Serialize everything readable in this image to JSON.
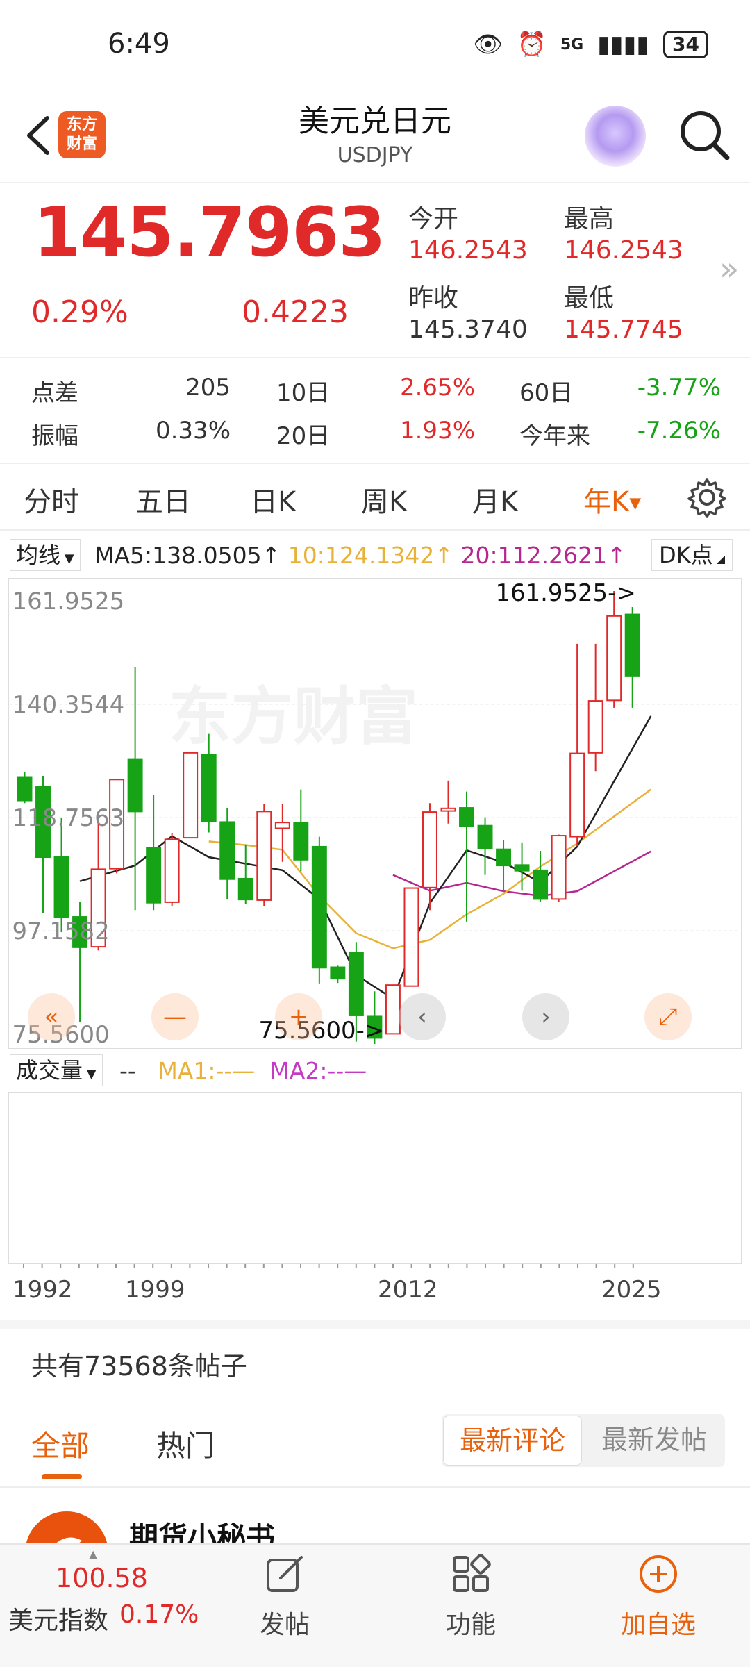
{
  "status": {
    "time": "6:49",
    "network": "5G",
    "battery": "34"
  },
  "header": {
    "title": "美元兑日元",
    "subtitle": "USDJPY",
    "logo_text": "东方财富"
  },
  "quote": {
    "price": "145.7963",
    "change_pct": "0.29%",
    "change_val": "0.4223",
    "open_label": "今开",
    "open": "146.2543",
    "high_label": "最高",
    "high": "146.2543",
    "prev_close_label": "昨收",
    "prev_close": "145.3740",
    "low_label": "最低",
    "low": "145.7745",
    "more": "»"
  },
  "stats": {
    "spread_label": "点差",
    "spread": "205",
    "d10_label": "10日",
    "d10": "2.65%",
    "d60_label": "60日",
    "d60": "-3.77%",
    "amplitude_label": "振幅",
    "amplitude": "0.33%",
    "d20_label": "20日",
    "d20": "1.93%",
    "ytd_label": "今年来",
    "ytd": "-7.26%"
  },
  "tabs": [
    "分时",
    "五日",
    "日K",
    "周K",
    "月K",
    "年K"
  ],
  "active_tab": "年K",
  "ma": {
    "selector": "均线",
    "ma5": "MA5:138.0505↑",
    "ma10": "10:124.1342↑",
    "ma20": "20:112.2621↑",
    "dk": "DK点"
  },
  "colors": {
    "up": "#e02a2a",
    "down": "#16a316",
    "accent": "#e8620d",
    "ma5": "#222222",
    "ma10": "#e8b23a",
    "ma20": "#b5268f"
  },
  "chart_data": {
    "type": "candlestick",
    "y_ticks": [
      "161.9525",
      "140.3544",
      "118.7563",
      "97.1582",
      "75.5600"
    ],
    "ylim": [
      75.56,
      161.9525
    ],
    "x_labels": [
      "1992",
      "1999",
      "2012",
      "2025"
    ],
    "annotations": {
      "high": "161.9525->",
      "low": "75.5600->"
    },
    "candles": [
      {
        "o": 126.5,
        "h": 127.5,
        "c": 122.0,
        "l": 121.5
      },
      {
        "o": 124.7,
        "h": 126.7,
        "c": 111.2,
        "l": 100.5
      },
      {
        "o": 111.3,
        "h": 118.7,
        "c": 99.7,
        "l": 96.9
      },
      {
        "o": 99.8,
        "h": 102.6,
        "c": 94.0,
        "l": 79.8
      },
      {
        "o": 94.1,
        "h": 118.7,
        "c": 108.9,
        "l": 93.4
      },
      {
        "o": 109.0,
        "h": 121.2,
        "c": 126.0,
        "l": 108.1
      },
      {
        "o": 129.8,
        "h": 147.5,
        "c": 119.9,
        "l": 101.1
      },
      {
        "o": 113.0,
        "h": 123.1,
        "c": 102.5,
        "l": 101.1
      },
      {
        "o": 102.6,
        "h": 115.7,
        "c": 114.6,
        "l": 101.9
      },
      {
        "o": 114.9,
        "h": 131.0,
        "c": 131.1,
        "l": 114.8
      },
      {
        "o": 130.8,
        "h": 134.7,
        "c": 118.0,
        "l": 115.9
      },
      {
        "o": 117.9,
        "h": 120.5,
        "c": 107.0,
        "l": 103.1
      },
      {
        "o": 107.1,
        "h": 113.6,
        "c": 103.1,
        "l": 102.3
      },
      {
        "o": 103.0,
        "h": 121.3,
        "c": 119.9,
        "l": 101.8
      },
      {
        "o": 116.7,
        "h": 121.3,
        "c": 117.8,
        "l": 110.3
      },
      {
        "o": 117.8,
        "h": 124.1,
        "c": 110.7,
        "l": 108.5
      },
      {
        "o": 113.2,
        "h": 115.1,
        "c": 90.1,
        "l": 87.1
      },
      {
        "o": 90.2,
        "h": 90.5,
        "c": 88.0,
        "l": 87.2
      },
      {
        "o": 93.0,
        "h": 95.0,
        "c": 81.0,
        "l": 76.0
      },
      {
        "o": 80.8,
        "h": 85.6,
        "c": 76.7,
        "l": 75.56
      },
      {
        "o": 77.5,
        "h": 84.3,
        "c": 86.8,
        "l": 77.5
      },
      {
        "o": 86.6,
        "h": 105.4,
        "c": 105.3,
        "l": 86.8
      },
      {
        "o": 105.4,
        "h": 121.5,
        "c": 119.8,
        "l": 101.1
      },
      {
        "o": 120.0,
        "h": 125.8,
        "c": 120.5,
        "l": 117.6
      },
      {
        "o": 120.6,
        "h": 123.7,
        "c": 117.1,
        "l": 98.9
      },
      {
        "o": 117.2,
        "h": 118.8,
        "c": 112.9,
        "l": 107.8
      },
      {
        "o": 112.7,
        "h": 114.5,
        "c": 109.6,
        "l": 104.6
      },
      {
        "o": 109.7,
        "h": 114.0,
        "c": 108.6,
        "l": 104.8
      },
      {
        "o": 108.7,
        "h": 112.4,
        "c": 103.2,
        "l": 102.6
      },
      {
        "o": 103.2,
        "h": 115.5,
        "c": 115.3,
        "l": 102.7
      },
      {
        "o": 115.1,
        "h": 151.9,
        "c": 131.0,
        "l": 113.3
      },
      {
        "o": 131.1,
        "h": 151.9,
        "c": 141.0,
        "l": 127.6
      },
      {
        "o": 141.1,
        "h": 161.9525,
        "c": 157.2,
        "l": 139.7
      },
      {
        "o": 157.5,
        "h": 158.9,
        "c": 145.8,
        "l": 139.7
      }
    ],
    "ma5_line": [
      [
        3,
        106.6
      ],
      [
        6,
        109.6
      ],
      [
        8,
        115.2
      ],
      [
        10,
        111.2
      ],
      [
        14,
        108.7
      ],
      [
        16,
        103.2
      ],
      [
        18,
        88.7
      ],
      [
        20,
        84.2
      ],
      [
        22,
        102.4
      ],
      [
        24,
        112.5
      ],
      [
        26,
        110.2
      ],
      [
        28,
        106.4
      ],
      [
        30,
        113.2
      ],
      [
        34,
        138.1
      ]
    ],
    "ma10_line": [
      [
        10,
        114.2
      ],
      [
        12,
        113.5
      ],
      [
        14,
        112.6
      ],
      [
        16,
        103.8
      ],
      [
        18,
        96.7
      ],
      [
        20,
        93.8
      ],
      [
        22,
        95.4
      ],
      [
        24,
        100.3
      ],
      [
        26,
        104.2
      ],
      [
        28,
        109.4
      ],
      [
        30,
        113.8
      ],
      [
        34,
        124.1
      ]
    ],
    "ma20_line": [
      [
        20,
        107.8
      ],
      [
        22,
        104.8
      ],
      [
        24,
        106.3
      ],
      [
        26,
        104.7
      ],
      [
        28,
        103.8
      ],
      [
        30,
        104.7
      ],
      [
        34,
        112.3
      ]
    ]
  },
  "volume": {
    "selector": "成交量",
    "dashes": "--",
    "ma1": "MA1:--—",
    "ma2": "MA2:--—"
  },
  "posts": {
    "count_text": "共有73568条帖子",
    "tab_all": "全部",
    "tab_hot": "热门",
    "sort_latest": "最新评论",
    "sort_new": "最新发帖",
    "first_author": "期货小秘书"
  },
  "bottom": {
    "index_value": "100.58",
    "index_label": "美元指数",
    "index_pct": "0.17%",
    "post": "发帖",
    "function": "功能",
    "add": "加自选"
  }
}
